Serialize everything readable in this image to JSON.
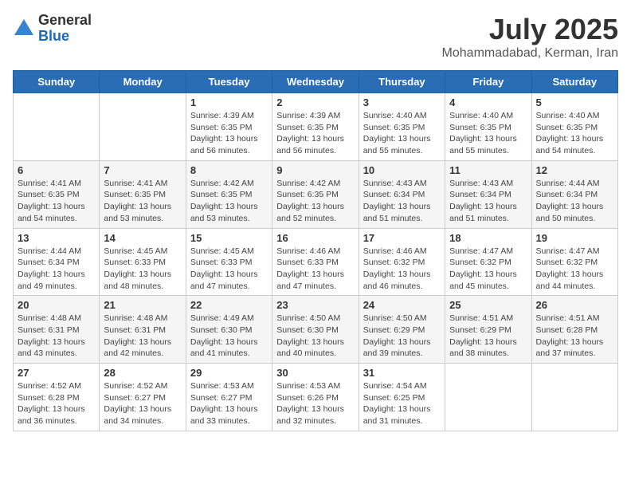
{
  "logo": {
    "general": "General",
    "blue": "Blue"
  },
  "header": {
    "month": "July 2025",
    "location": "Mohammadabad, Kerman, Iran"
  },
  "weekdays": [
    "Sunday",
    "Monday",
    "Tuesday",
    "Wednesday",
    "Thursday",
    "Friday",
    "Saturday"
  ],
  "weeks": [
    [
      {
        "day": "",
        "sunrise": "",
        "sunset": "",
        "daylight": ""
      },
      {
        "day": "",
        "sunrise": "",
        "sunset": "",
        "daylight": ""
      },
      {
        "day": "1",
        "sunrise": "Sunrise: 4:39 AM",
        "sunset": "Sunset: 6:35 PM",
        "daylight": "Daylight: 13 hours and 56 minutes."
      },
      {
        "day": "2",
        "sunrise": "Sunrise: 4:39 AM",
        "sunset": "Sunset: 6:35 PM",
        "daylight": "Daylight: 13 hours and 56 minutes."
      },
      {
        "day": "3",
        "sunrise": "Sunrise: 4:40 AM",
        "sunset": "Sunset: 6:35 PM",
        "daylight": "Daylight: 13 hours and 55 minutes."
      },
      {
        "day": "4",
        "sunrise": "Sunrise: 4:40 AM",
        "sunset": "Sunset: 6:35 PM",
        "daylight": "Daylight: 13 hours and 55 minutes."
      },
      {
        "day": "5",
        "sunrise": "Sunrise: 4:40 AM",
        "sunset": "Sunset: 6:35 PM",
        "daylight": "Daylight: 13 hours and 54 minutes."
      }
    ],
    [
      {
        "day": "6",
        "sunrise": "Sunrise: 4:41 AM",
        "sunset": "Sunset: 6:35 PM",
        "daylight": "Daylight: 13 hours and 54 minutes."
      },
      {
        "day": "7",
        "sunrise": "Sunrise: 4:41 AM",
        "sunset": "Sunset: 6:35 PM",
        "daylight": "Daylight: 13 hours and 53 minutes."
      },
      {
        "day": "8",
        "sunrise": "Sunrise: 4:42 AM",
        "sunset": "Sunset: 6:35 PM",
        "daylight": "Daylight: 13 hours and 53 minutes."
      },
      {
        "day": "9",
        "sunrise": "Sunrise: 4:42 AM",
        "sunset": "Sunset: 6:35 PM",
        "daylight": "Daylight: 13 hours and 52 minutes."
      },
      {
        "day": "10",
        "sunrise": "Sunrise: 4:43 AM",
        "sunset": "Sunset: 6:34 PM",
        "daylight": "Daylight: 13 hours and 51 minutes."
      },
      {
        "day": "11",
        "sunrise": "Sunrise: 4:43 AM",
        "sunset": "Sunset: 6:34 PM",
        "daylight": "Daylight: 13 hours and 51 minutes."
      },
      {
        "day": "12",
        "sunrise": "Sunrise: 4:44 AM",
        "sunset": "Sunset: 6:34 PM",
        "daylight": "Daylight: 13 hours and 50 minutes."
      }
    ],
    [
      {
        "day": "13",
        "sunrise": "Sunrise: 4:44 AM",
        "sunset": "Sunset: 6:34 PM",
        "daylight": "Daylight: 13 hours and 49 minutes."
      },
      {
        "day": "14",
        "sunrise": "Sunrise: 4:45 AM",
        "sunset": "Sunset: 6:33 PM",
        "daylight": "Daylight: 13 hours and 48 minutes."
      },
      {
        "day": "15",
        "sunrise": "Sunrise: 4:45 AM",
        "sunset": "Sunset: 6:33 PM",
        "daylight": "Daylight: 13 hours and 47 minutes."
      },
      {
        "day": "16",
        "sunrise": "Sunrise: 4:46 AM",
        "sunset": "Sunset: 6:33 PM",
        "daylight": "Daylight: 13 hours and 47 minutes."
      },
      {
        "day": "17",
        "sunrise": "Sunrise: 4:46 AM",
        "sunset": "Sunset: 6:32 PM",
        "daylight": "Daylight: 13 hours and 46 minutes."
      },
      {
        "day": "18",
        "sunrise": "Sunrise: 4:47 AM",
        "sunset": "Sunset: 6:32 PM",
        "daylight": "Daylight: 13 hours and 45 minutes."
      },
      {
        "day": "19",
        "sunrise": "Sunrise: 4:47 AM",
        "sunset": "Sunset: 6:32 PM",
        "daylight": "Daylight: 13 hours and 44 minutes."
      }
    ],
    [
      {
        "day": "20",
        "sunrise": "Sunrise: 4:48 AM",
        "sunset": "Sunset: 6:31 PM",
        "daylight": "Daylight: 13 hours and 43 minutes."
      },
      {
        "day": "21",
        "sunrise": "Sunrise: 4:48 AM",
        "sunset": "Sunset: 6:31 PM",
        "daylight": "Daylight: 13 hours and 42 minutes."
      },
      {
        "day": "22",
        "sunrise": "Sunrise: 4:49 AM",
        "sunset": "Sunset: 6:30 PM",
        "daylight": "Daylight: 13 hours and 41 minutes."
      },
      {
        "day": "23",
        "sunrise": "Sunrise: 4:50 AM",
        "sunset": "Sunset: 6:30 PM",
        "daylight": "Daylight: 13 hours and 40 minutes."
      },
      {
        "day": "24",
        "sunrise": "Sunrise: 4:50 AM",
        "sunset": "Sunset: 6:29 PM",
        "daylight": "Daylight: 13 hours and 39 minutes."
      },
      {
        "day": "25",
        "sunrise": "Sunrise: 4:51 AM",
        "sunset": "Sunset: 6:29 PM",
        "daylight": "Daylight: 13 hours and 38 minutes."
      },
      {
        "day": "26",
        "sunrise": "Sunrise: 4:51 AM",
        "sunset": "Sunset: 6:28 PM",
        "daylight": "Daylight: 13 hours and 37 minutes."
      }
    ],
    [
      {
        "day": "27",
        "sunrise": "Sunrise: 4:52 AM",
        "sunset": "Sunset: 6:28 PM",
        "daylight": "Daylight: 13 hours and 36 minutes."
      },
      {
        "day": "28",
        "sunrise": "Sunrise: 4:52 AM",
        "sunset": "Sunset: 6:27 PM",
        "daylight": "Daylight: 13 hours and 34 minutes."
      },
      {
        "day": "29",
        "sunrise": "Sunrise: 4:53 AM",
        "sunset": "Sunset: 6:27 PM",
        "daylight": "Daylight: 13 hours and 33 minutes."
      },
      {
        "day": "30",
        "sunrise": "Sunrise: 4:53 AM",
        "sunset": "Sunset: 6:26 PM",
        "daylight": "Daylight: 13 hours and 32 minutes."
      },
      {
        "day": "31",
        "sunrise": "Sunrise: 4:54 AM",
        "sunset": "Sunset: 6:25 PM",
        "daylight": "Daylight: 13 hours and 31 minutes."
      },
      {
        "day": "",
        "sunrise": "",
        "sunset": "",
        "daylight": ""
      },
      {
        "day": "",
        "sunrise": "",
        "sunset": "",
        "daylight": ""
      }
    ]
  ]
}
